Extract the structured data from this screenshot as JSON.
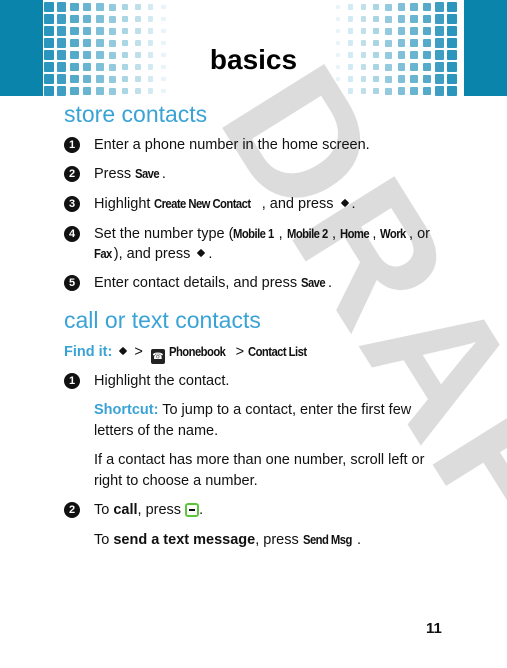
{
  "header": {
    "title": "basics",
    "accent": "#0a84aa"
  },
  "watermark": "DRAFT",
  "section1": {
    "heading": "store contacts",
    "steps": [
      {
        "n": "1",
        "text": "Enter a phone number in the home screen."
      },
      {
        "n": "2",
        "pre": "Press ",
        "key": "Save",
        "post": "."
      },
      {
        "n": "3",
        "pre": "Highlight ",
        "key": "Create New Contact",
        "post": ", and press"
      },
      {
        "n": "4",
        "pre": "Set the number type (",
        "k1": "Mobile 1",
        "k2": "Mobile 2",
        "k3": "Home",
        "k4": "Work",
        "mid": ", or",
        "k5": "Fax",
        "post": "), and press"
      },
      {
        "n": "5",
        "pre": "Enter contact details, and press ",
        "key": "Save",
        "post": "."
      }
    ]
  },
  "section2": {
    "heading": "call or text contacts",
    "find_label": "Find it:",
    "path": [
      "Phonebook",
      "Contact List"
    ],
    "step1": {
      "n": "1",
      "text": "Highlight the contact."
    },
    "shortcut_label": "Shortcut:",
    "shortcut_text1": " To jump to a contact, enter the first few",
    "shortcut_text2": "letters of the name.",
    "note1": "If a contact has more than one number, scroll left or",
    "note2": "right to choose a number.",
    "step2": {
      "n": "2",
      "pre": "To ",
      "bold": "call",
      "post": ", press"
    },
    "send": {
      "pre": "To ",
      "bold": "send a text message",
      "mid": ", press ",
      "key": "Send Msg",
      "post": "."
    }
  },
  "page_number": "11"
}
